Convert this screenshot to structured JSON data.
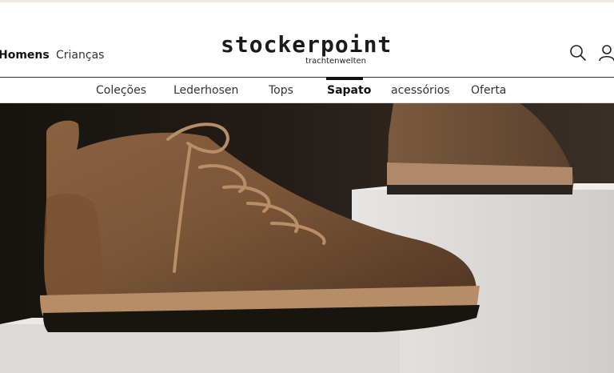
{
  "header": {
    "gender_tabs": [
      {
        "label": "Homens"
      },
      {
        "label": "Crianças"
      }
    ],
    "logo": {
      "main": "stockerpoint",
      "sub": "trachtenwelten"
    },
    "icons": [
      "search-icon",
      "user-icon"
    ]
  },
  "nav": {
    "items": [
      {
        "label": "Coleções"
      },
      {
        "label": "Lederhosen"
      },
      {
        "label": "Tops"
      },
      {
        "label": "Sapato"
      },
      {
        "label": "acessórios"
      },
      {
        "label": "Oferta"
      }
    ],
    "active": "Sapato"
  },
  "hero": {
    "subject": "brown suede lace-up shoe on white pedestal"
  },
  "colors": {
    "text": "#222222",
    "accent": "#111111",
    "suede": "#7a5638",
    "pedestal": "#dcdad8"
  }
}
